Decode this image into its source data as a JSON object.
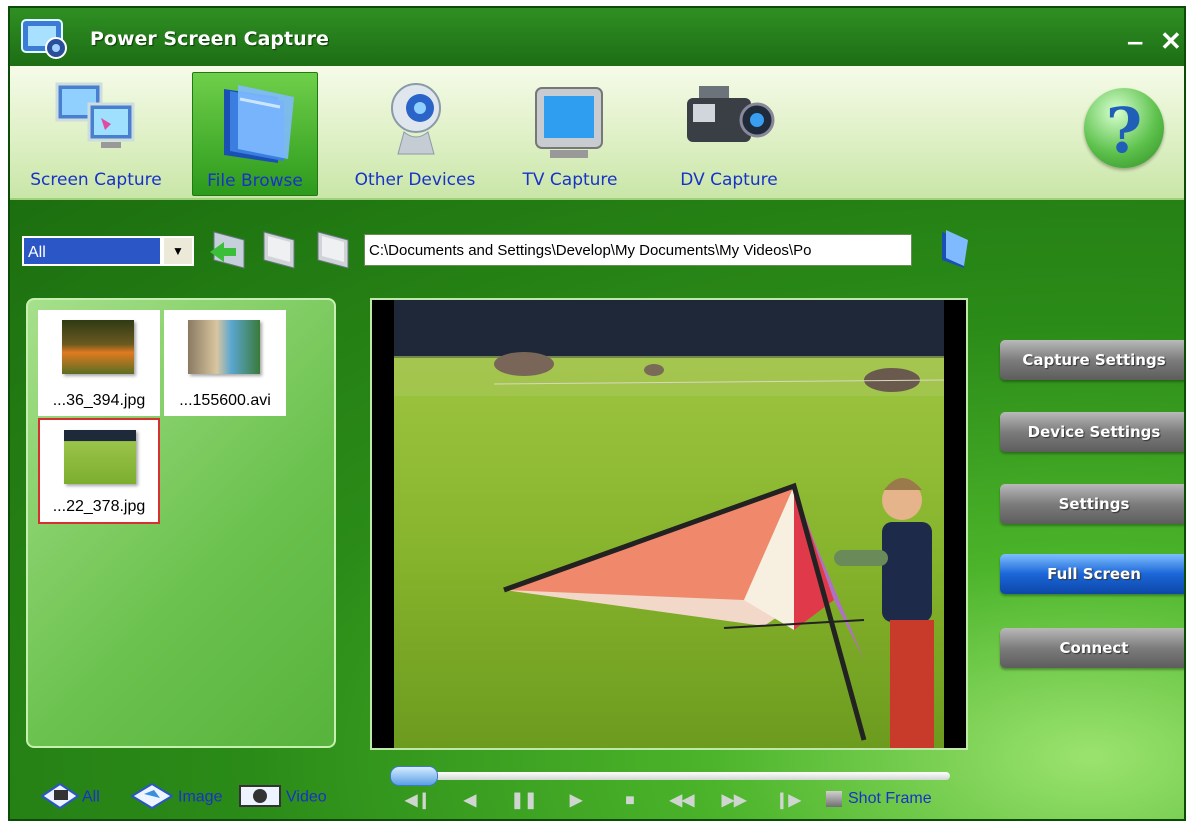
{
  "window": {
    "title": "Power Screen Capture",
    "minimize_symbol": "‒",
    "close_symbol": "✕"
  },
  "toolbar": {
    "items": [
      {
        "label": "Screen Capture",
        "icon": "monitors-icon"
      },
      {
        "label": "File Browse",
        "icon": "folder-icon",
        "active": true
      },
      {
        "label": "Other Devices",
        "icon": "webcam-icon"
      },
      {
        "label": "TV Capture",
        "icon": "tv-icon"
      },
      {
        "label": "DV Capture",
        "icon": "camcorder-icon"
      }
    ],
    "help_symbol": "?"
  },
  "browser": {
    "filter_value": "All",
    "path": "C:\\Documents and Settings\\Develop\\My Documents\\My Videos\\Po"
  },
  "thumbnails": [
    {
      "name": "...36_394.jpg",
      "selected": false
    },
    {
      "name": "...155600.avi",
      "selected": false
    },
    {
      "name": "...22_378.jpg",
      "selected": true
    }
  ],
  "side_buttons": {
    "capture_settings": "Capture Settings",
    "device_settings": "Device Settings",
    "settings": "Settings",
    "full_screen": "Full Screen",
    "connect": "Connect"
  },
  "bottom": {
    "filter_all": "All",
    "filter_image": "Image",
    "filter_video": "Video",
    "shot_frame": "Shot Frame",
    "seek_progress": 0
  },
  "colors": {
    "frame_green": "#1f7a12",
    "label_blue": "#1832c8",
    "active_button_blue": "#1b66d8"
  }
}
